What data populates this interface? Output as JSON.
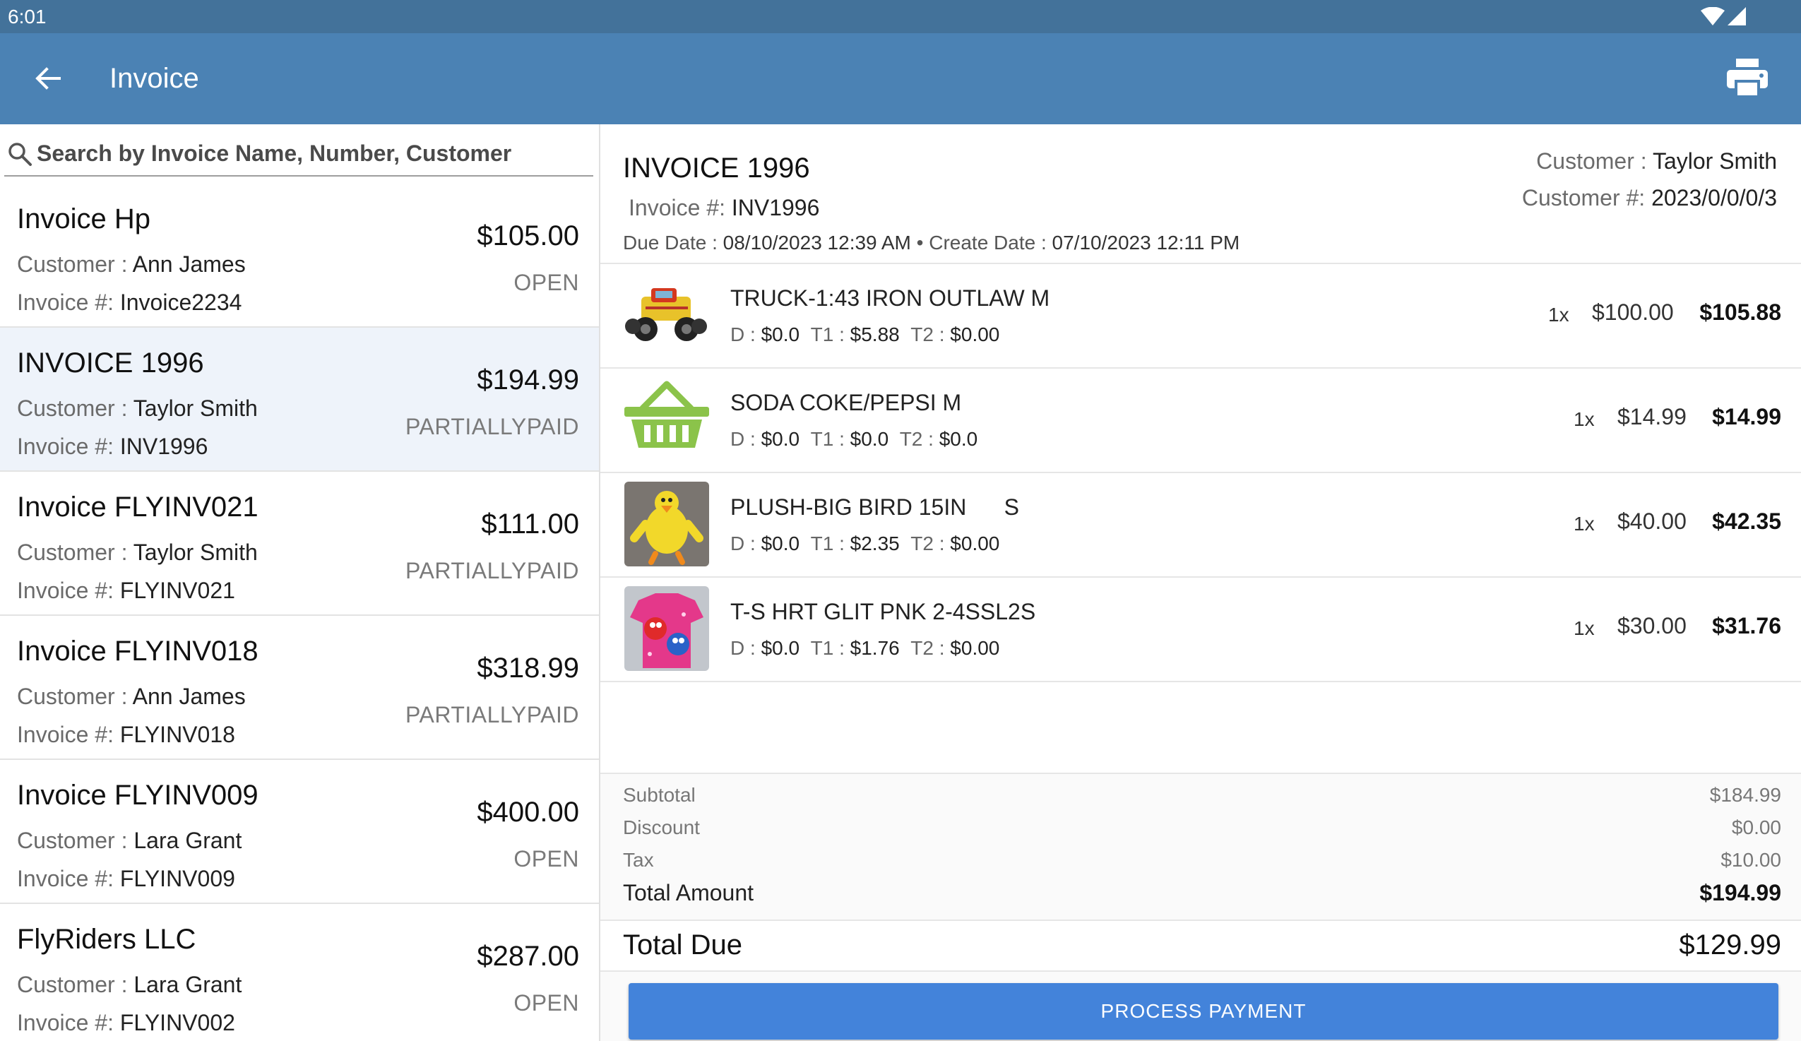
{
  "status_bar": {
    "time": "6:01"
  },
  "app_bar": {
    "title": "Invoice"
  },
  "search": {
    "placeholder": "Search by Invoice Name, Number, Customer",
    "value": ""
  },
  "labels": {
    "customer": "Customer : ",
    "invoice_num": "Invoice #: ",
    "customer_num": "Customer #: ",
    "due_date": "Due Date : ",
    "create_date": " • Create Date : ",
    "d": "D : ",
    "t1": "T1 : ",
    "t2": "T2 : "
  },
  "invoices": [
    {
      "name": "Invoice Hp",
      "customer": "Ann James",
      "number": "Invoice2234",
      "amount": "$105.00",
      "status": "OPEN"
    },
    {
      "name": "INVOICE 1996",
      "customer": "Taylor Smith",
      "number": "INV1996",
      "amount": "$194.99",
      "status": "PARTIALLYPAID"
    },
    {
      "name": "Invoice FLYINV021",
      "customer": "Taylor Smith",
      "number": "FLYINV021",
      "amount": "$111.00",
      "status": "PARTIALLYPAID"
    },
    {
      "name": "Invoice FLYINV018",
      "customer": "Ann James",
      "number": "FLYINV018",
      "amount": "$318.99",
      "status": "PARTIALLYPAID"
    },
    {
      "name": "Invoice FLYINV009",
      "customer": "Lara Grant",
      "number": "FLYINV009",
      "amount": "$400.00",
      "status": "OPEN"
    },
    {
      "name": "FlyRiders LLC",
      "customer": "Lara Grant",
      "number": "FLYINV002",
      "amount": "$287.00",
      "status": "OPEN"
    }
  ],
  "detail": {
    "title": "INVOICE 1996",
    "number": "INV1996",
    "due_date": "08/10/2023 12:39 AM",
    "create_date": "07/10/2023 12:11 PM",
    "customer": "Taylor Smith",
    "customer_num": "2023/0/0/0/3",
    "items": [
      {
        "name": "TRUCK-1:43 IRON OUTLAW M",
        "d": "$0.0",
        "t1": "$5.88",
        "t2": "$0.00",
        "qty": "1x",
        "price": "$100.00",
        "total": "$105.88",
        "thumb_icon": "toy-truck-image"
      },
      {
        "name": "SODA COKE/PEPSI M",
        "d": "$0.0",
        "t1": "$0.0",
        "t2": "$0.0",
        "qty": "1x",
        "price": "$14.99",
        "total": "$14.99",
        "thumb_icon": "basket-icon"
      },
      {
        "name": "PLUSH-BIG BIRD 15IN      S",
        "d": "$0.0",
        "t1": "$2.35",
        "t2": "$0.00",
        "qty": "1x",
        "price": "$40.00",
        "total": "$42.35",
        "thumb_icon": "plush-bird-image"
      },
      {
        "name": "T-S HRT GLIT PNK 2-4SSL2S",
        "d": "$0.0",
        "t1": "$1.76",
        "t2": "$0.00",
        "qty": "1x",
        "price": "$30.00",
        "total": "$31.76",
        "thumb_icon": "tshirt-image"
      }
    ],
    "totals": {
      "subtotal_label": "Subtotal",
      "subtotal": "$184.99",
      "discount_label": "Discount",
      "discount": "$0.00",
      "tax_label": "Tax",
      "tax": "$10.00",
      "total_label": "Total Amount",
      "total": "$194.99",
      "due_label": "Total Due",
      "due": "$129.99"
    },
    "pay_button": "PROCESS PAYMENT"
  },
  "colors": {
    "status_bar": "#43729a",
    "app_bar": "#4b82b4",
    "selected_row": "#eef3fa",
    "pay_button": "#4383da",
    "basket_icon": "#8bc34a"
  }
}
